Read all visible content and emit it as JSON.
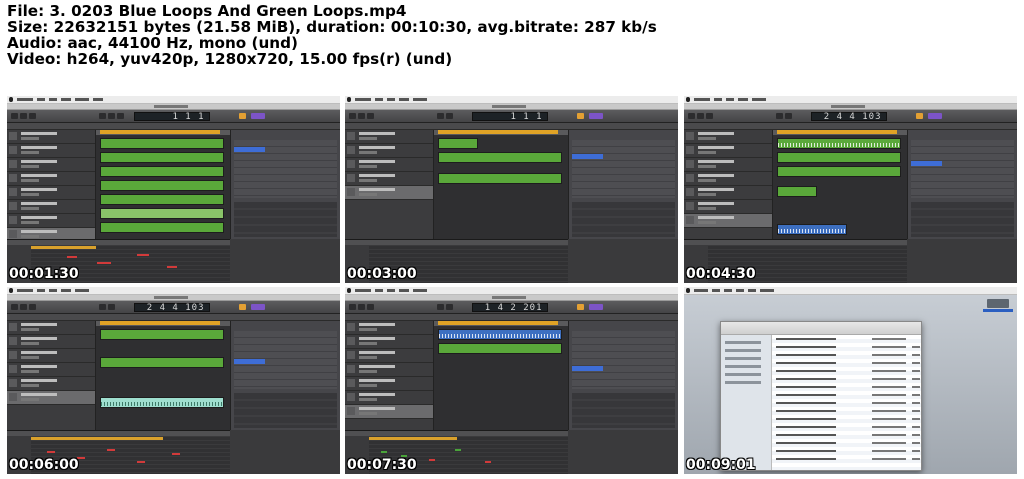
{
  "info": {
    "line1": "File: 3. 0203 Blue Loops And Green Loops.mp4",
    "line2": "Size: 22632151 bytes (21.58 MiB), duration: 00:10:30, avg.bitrate: 287 kb/s",
    "line3": "Audio: aac, 44100 Hz, mono (und)",
    "line4": "Video: h264, yuv420p, 1280x720, 15.00 fps(r) (und)"
  },
  "thumbnails": [
    {
      "timestamp": "00:01:30",
      "lcd": "1 1 1"
    },
    {
      "timestamp": "00:03:00",
      "lcd": "1 1 1"
    },
    {
      "timestamp": "00:04:30",
      "lcd": "2 4 4 103"
    },
    {
      "timestamp": "00:06:00",
      "lcd": "2 4 4 103"
    },
    {
      "timestamp": "00:07:30",
      "lcd": "1 4 2 201"
    },
    {
      "timestamp": "00:09:01"
    }
  ],
  "colors": {
    "region_green": "#5aa83a",
    "region_blue": "#3d6fc0",
    "cycle_orange": "#e0a326",
    "loop_highlight": "#3e6dd6"
  }
}
